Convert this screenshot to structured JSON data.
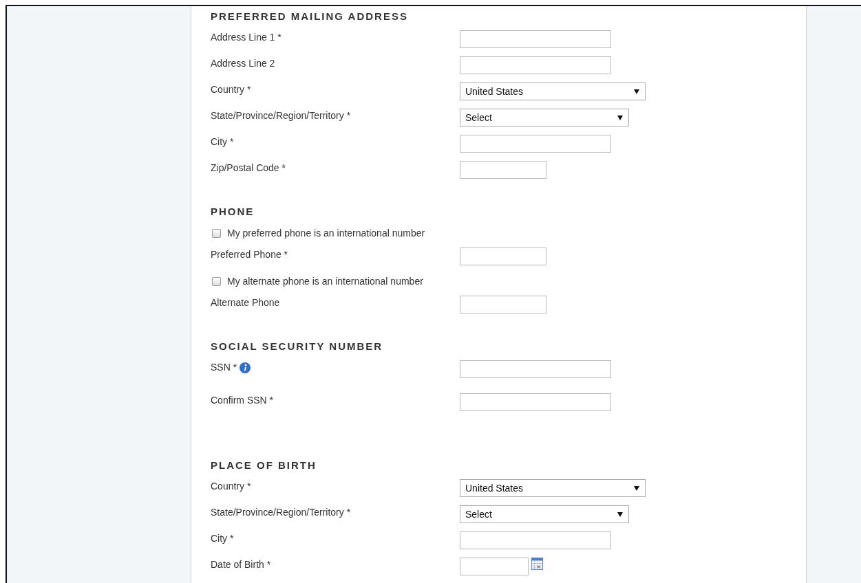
{
  "sections": [
    {
      "heading": "PREFERRED MAILING ADDRESS",
      "fields": [
        {
          "kind": "text",
          "label": "Address Line 1 *"
        },
        {
          "kind": "text",
          "label": "Address Line 2"
        },
        {
          "kind": "select",
          "label": "Country *",
          "value": "United States"
        },
        {
          "kind": "narrow-select",
          "label": "State/Province/Region/Territory *",
          "value": "Select"
        },
        {
          "kind": "text",
          "label": "City *"
        },
        {
          "kind": "short-text",
          "label": "Zip/Postal Code *"
        }
      ]
    },
    {
      "heading": "PHONE",
      "fields": [
        {
          "kind": "checkbox",
          "label": "My preferred phone is an international number",
          "checked": false
        },
        {
          "kind": "short-text",
          "label": "Preferred Phone *"
        },
        {
          "kind": "checkbox",
          "label": "My alternate phone is an international number",
          "checked": false
        },
        {
          "kind": "short-text",
          "label": "Alternate Phone"
        }
      ]
    },
    {
      "heading": "SOCIAL SECURITY NUMBER",
      "fields": [
        {
          "kind": "text",
          "label": "SSN *",
          "info": true
        },
        {
          "kind": "text",
          "label": "Confirm SSN *"
        }
      ]
    },
    {
      "heading": "PLACE OF BIRTH",
      "fields": [
        {
          "kind": "select",
          "label": "Country *",
          "value": "United States"
        },
        {
          "kind": "narrow-select",
          "label": "State/Province/Region/Territory *",
          "value": "Select"
        },
        {
          "kind": "text",
          "label": "City *"
        },
        {
          "kind": "date",
          "label": "Date of Birth *"
        }
      ]
    }
  ]
}
